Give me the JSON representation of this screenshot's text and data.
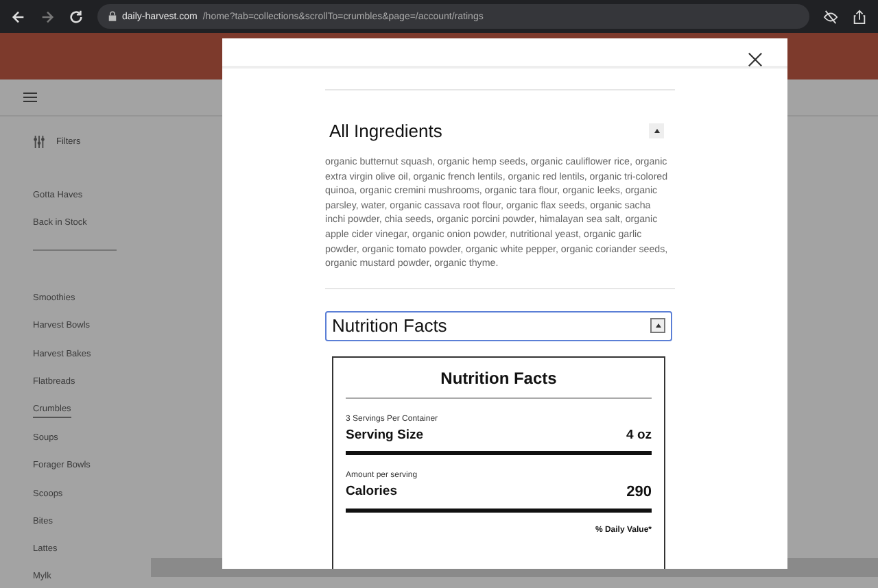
{
  "browser": {
    "domain": "daily-harvest.com",
    "path": "/home?tab=collections&scrollTo=crumbles&page=/account/ratings"
  },
  "sidebar": {
    "filters_label": "Filters",
    "featured": [
      {
        "label": "Gotta Haves",
        "selected": false
      },
      {
        "label": "Back in Stock",
        "selected": false
      }
    ],
    "categories": [
      {
        "label": "Smoothies",
        "selected": false
      },
      {
        "label": "Harvest Bowls",
        "selected": false
      },
      {
        "label": "Harvest Bakes",
        "selected": false
      },
      {
        "label": "Flatbreads",
        "selected": false
      },
      {
        "label": "Crumbles",
        "selected": true
      },
      {
        "label": "Soups",
        "selected": false
      },
      {
        "label": "Forager Bowls",
        "selected": false
      },
      {
        "label": "Scoops",
        "selected": false
      },
      {
        "label": "Bites",
        "selected": false
      },
      {
        "label": "Lattes",
        "selected": false
      },
      {
        "label": "Mylk",
        "selected": false
      }
    ]
  },
  "modal": {
    "sections": [
      {
        "kind": "ingredients",
        "title": "All Ingredients",
        "expanded": true,
        "focused": false,
        "body": "organic butternut squash, organic hemp seeds, organic cauliflower rice, organic extra virgin olive oil, organic french lentils, organic red lentils, organic tri-colored quinoa, organic cremini mushrooms, organic tara flour, organic leeks, organic parsley, water, organic cassava root flour, organic flax seeds, organic sacha inchi powder, chia seeds, organic porcini powder, himalayan sea salt, organic apple cider vinegar, organic onion powder, nutritional yeast, organic garlic powder, organic tomato powder, organic white pepper, organic coriander seeds, organic mustard powder, organic thyme."
      },
      {
        "kind": "nutrition",
        "title": "Nutrition Facts",
        "expanded": true,
        "focused": true,
        "label": {
          "title": "Nutrition Facts",
          "servings": "3 Servings Per Container",
          "serving_size_label": "Serving Size",
          "serving_size_value": "4 oz",
          "amount_label": "Amount per serving",
          "calories_label": "Calories",
          "calories_value": "290",
          "daily_value_label": "% Daily Value*"
        }
      }
    ]
  }
}
